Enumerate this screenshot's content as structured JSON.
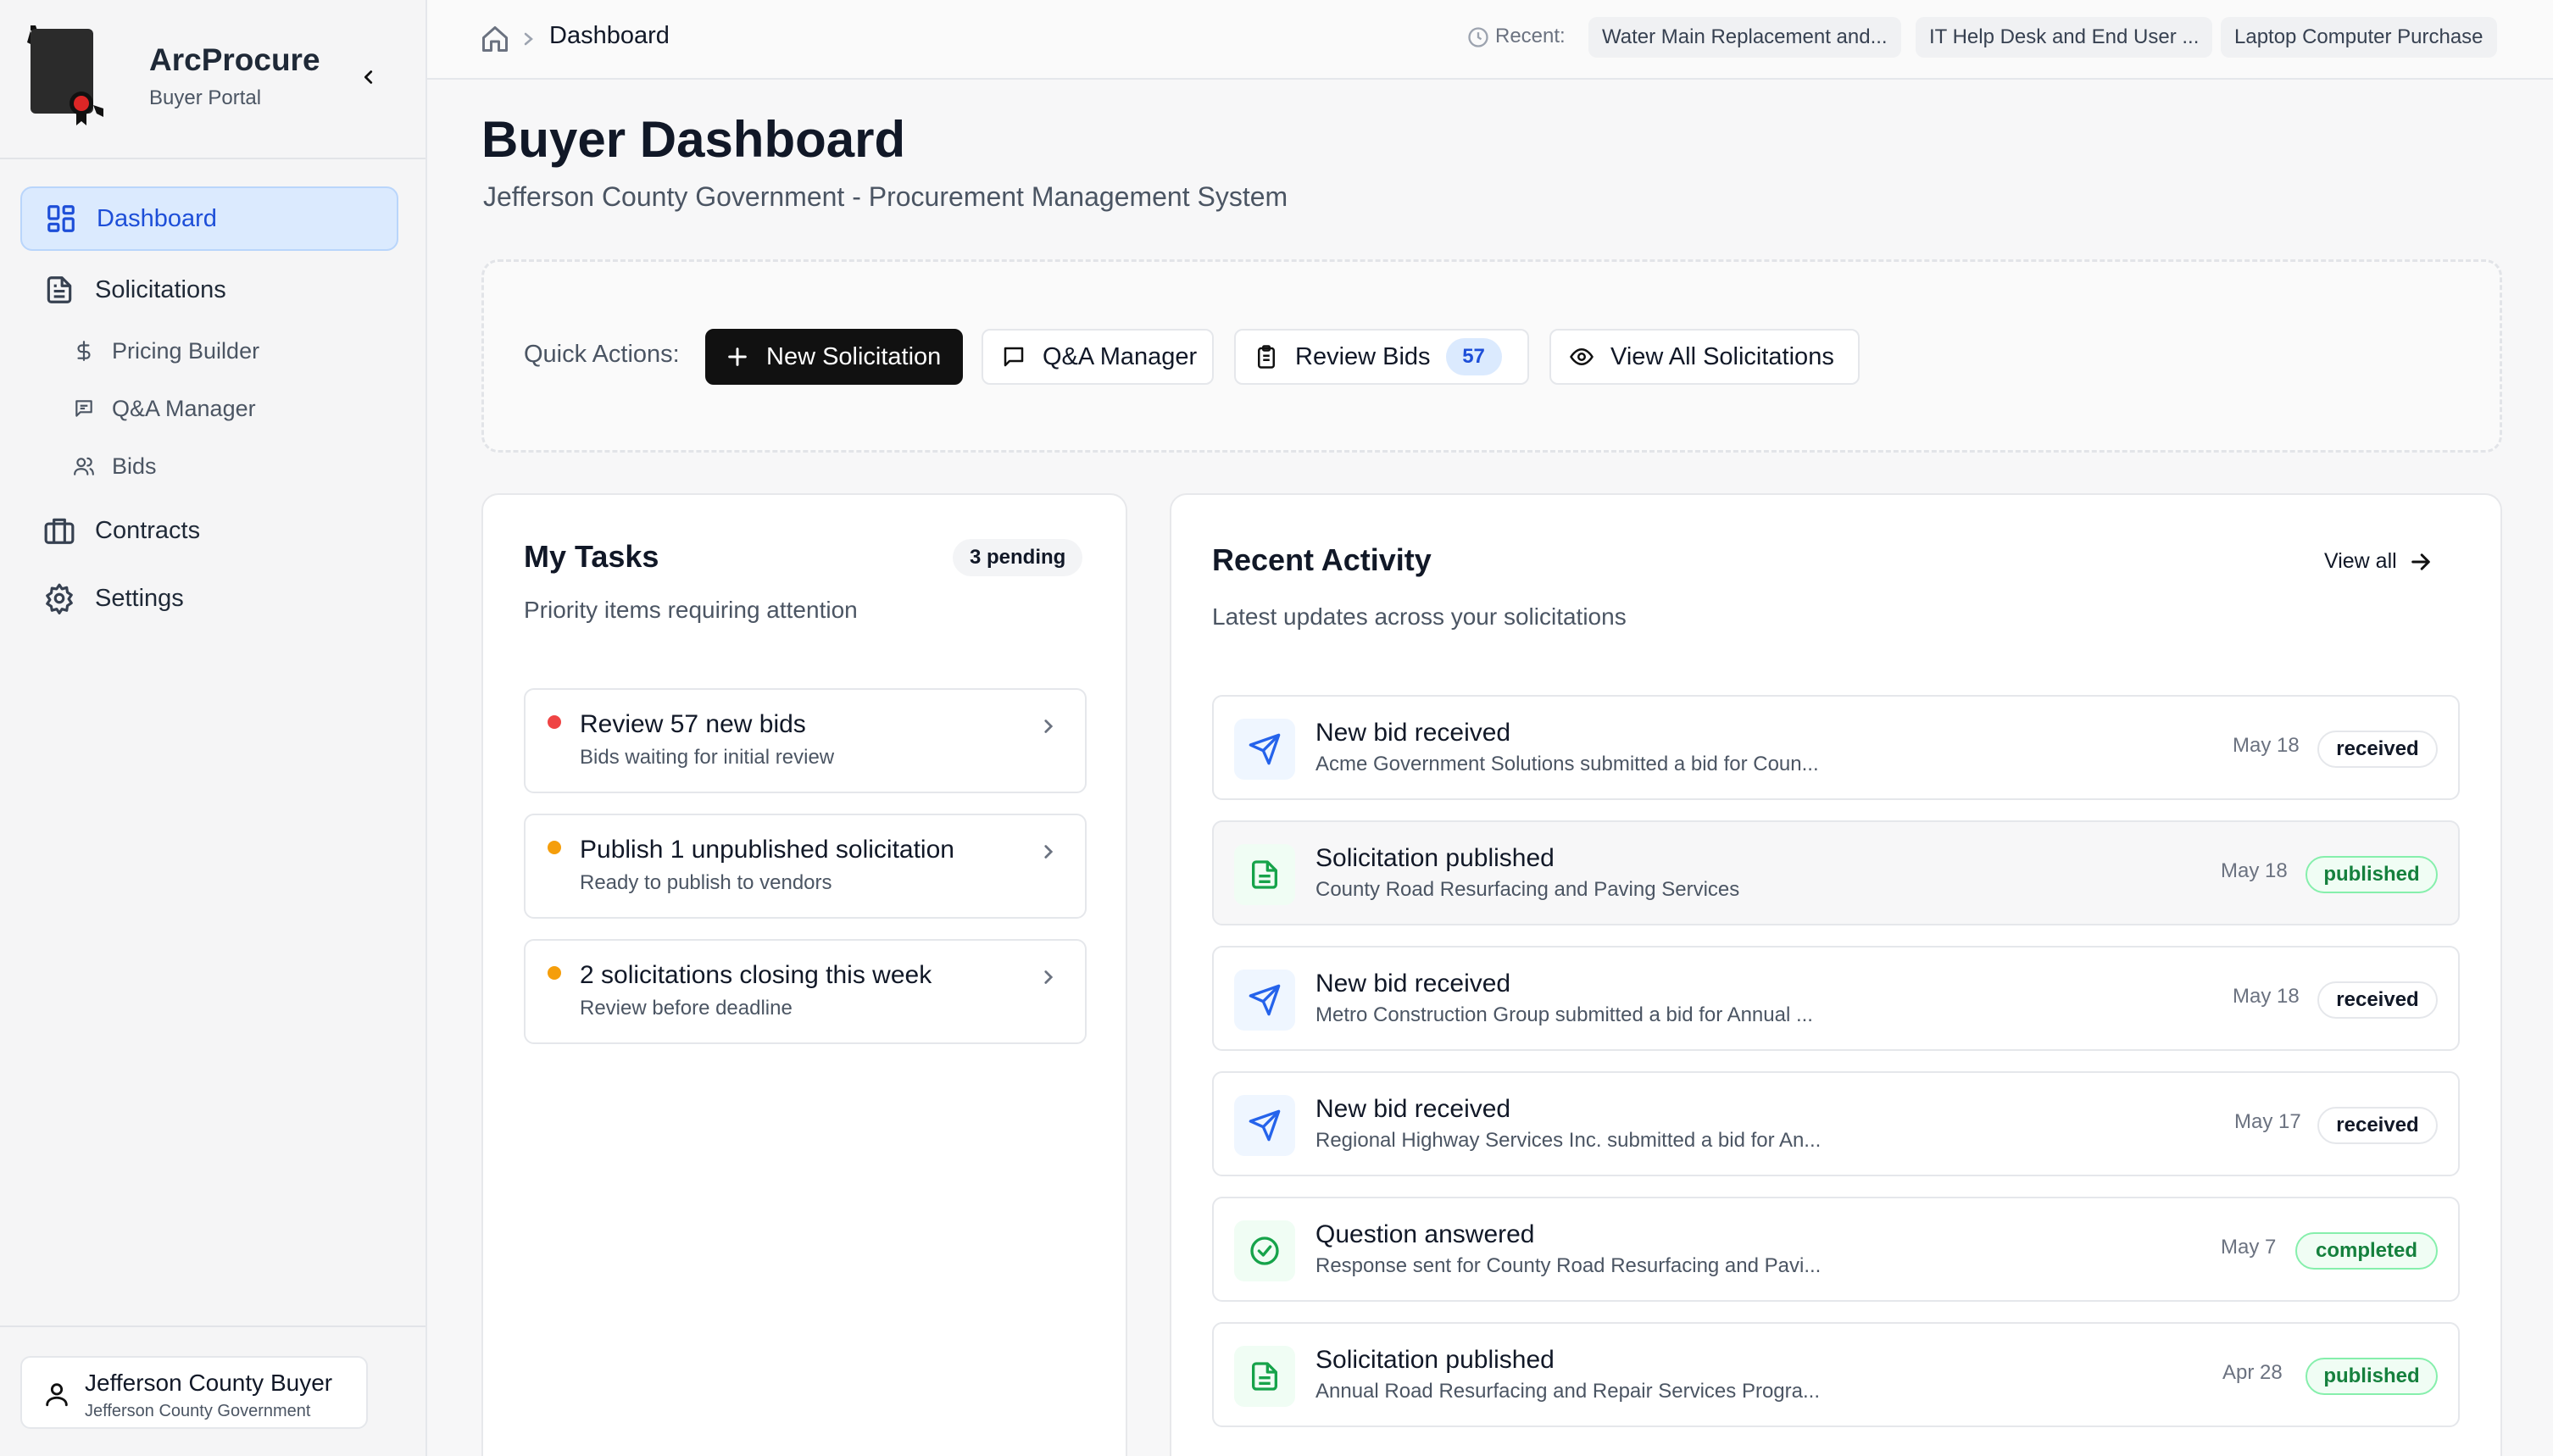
{
  "brand": {
    "name": "ArcProcure",
    "subtitle": "Buyer Portal"
  },
  "sidebar": {
    "items": [
      {
        "label": "Dashboard",
        "icon": "dashboard-grid-icon",
        "active": true
      },
      {
        "label": "Solicitations",
        "icon": "document-icon"
      },
      {
        "label": "Contracts",
        "icon": "briefcase-icon"
      },
      {
        "label": "Settings",
        "icon": "gear-icon"
      }
    ],
    "subitems": [
      {
        "label": "Pricing Builder",
        "icon": "dollar-icon"
      },
      {
        "label": "Q&A Manager",
        "icon": "message-icon"
      },
      {
        "label": "Bids",
        "icon": "users-icon"
      }
    ],
    "user": {
      "name": "Jefferson County Buyer",
      "org": "Jefferson County Government"
    }
  },
  "topbar": {
    "breadcrumb": "Dashboard",
    "recent_label": "Recent:",
    "recent": [
      "Water Main Replacement and...",
      "IT Help Desk and End User ...",
      "Laptop Computer Purchase"
    ]
  },
  "header": {
    "title": "Buyer Dashboard",
    "subtitle": "Jefferson County Government - Procurement Management System"
  },
  "quick_actions": {
    "label": "Quick Actions:",
    "new_solicitation": "New Solicitation",
    "qa_manager": "Q&A Manager",
    "review_bids": "Review Bids",
    "review_bids_count": "57",
    "view_all": "View All Solicitations"
  },
  "tasks": {
    "title": "My Tasks",
    "badge": "3 pending",
    "subtitle": "Priority items requiring attention",
    "items": [
      {
        "title": "Review 57 new bids",
        "sub": "Bids waiting for initial review",
        "color": "#ef4444"
      },
      {
        "title": "Publish 1 unpublished solicitation",
        "sub": "Ready to publish to vendors",
        "color": "#f59e0b"
      },
      {
        "title": "2 solicitations closing this week",
        "sub": "Review before deadline",
        "color": "#f59e0b"
      }
    ]
  },
  "activity": {
    "title": "Recent Activity",
    "subtitle": "Latest updates across your solicitations",
    "view_all": "View all",
    "items": [
      {
        "title": "New bid received",
        "sub": "Acme Government Solutions submitted a bid for Coun...",
        "date": "May 18",
        "status": "received",
        "icon": "send-icon"
      },
      {
        "title": "Solicitation published",
        "sub": "County Road Resurfacing and Paving Services",
        "date": "May 18",
        "status": "published",
        "icon": "document-icon"
      },
      {
        "title": "New bid received",
        "sub": "Metro Construction Group submitted a bid for Annual ...",
        "date": "May 18",
        "status": "received",
        "icon": "send-icon"
      },
      {
        "title": "New bid received",
        "sub": "Regional Highway Services Inc. submitted a bid for An...",
        "date": "May 17",
        "status": "received",
        "icon": "send-icon"
      },
      {
        "title": "Question answered",
        "sub": "Response sent for County Road Resurfacing and Pavi...",
        "date": "May 7",
        "status": "completed",
        "icon": "check-circle-icon"
      },
      {
        "title": "Solicitation published",
        "sub": "Annual Road Resurfacing and Repair Services Progra...",
        "date": "Apr 28",
        "status": "published",
        "icon": "document-icon"
      }
    ]
  },
  "colors": {
    "accent": "#1d4ed8",
    "accent_bg": "#dbeafe",
    "success": "#15803d",
    "primary_button": "#111111"
  }
}
